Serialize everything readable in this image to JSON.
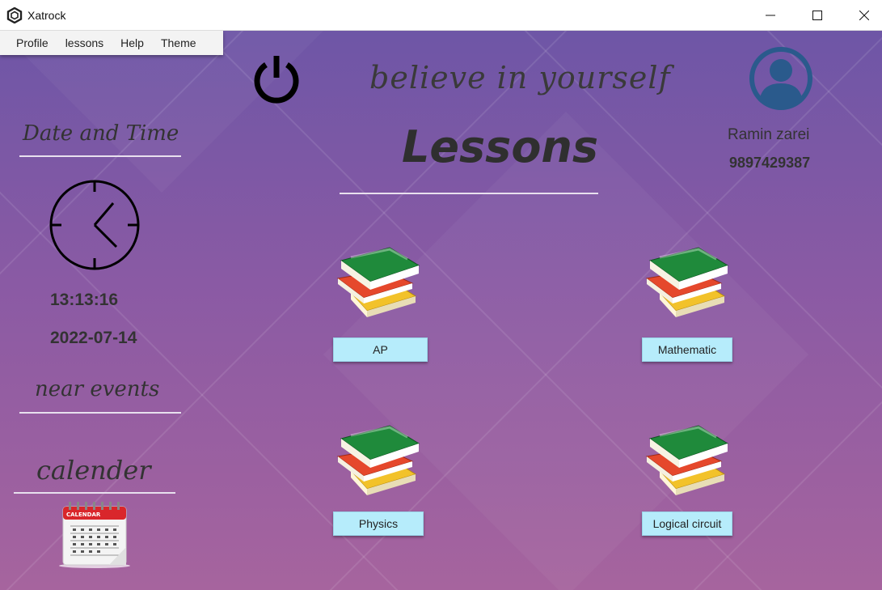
{
  "window": {
    "title": "Xatrock",
    "minimize_icon": "minimize-icon",
    "maximize_icon": "maximize-icon",
    "close_icon": "close-icon"
  },
  "menu": {
    "items": [
      "Profile",
      "lessons",
      "Help",
      "Theme"
    ]
  },
  "header": {
    "motto": "believe in yourself",
    "title": "Lessons"
  },
  "user": {
    "name": "Ramin zarei",
    "phone": "9897429387",
    "avatar_icon": "user-avatar-icon"
  },
  "sidebar": {
    "date_time_label": "Date and Time",
    "time": "13:13:16",
    "date": "2022-07-14",
    "near_events_label": "near events",
    "calendar_label": "calender",
    "calendar_icon_text": "CALENDAR"
  },
  "lessons": [
    {
      "label": "AP"
    },
    {
      "label": "Mathematic"
    },
    {
      "label": "Physics"
    },
    {
      "label": "Logical circuit"
    }
  ],
  "colors": {
    "accent_button": "#b6ecfb",
    "background_top": "#6e56a6",
    "background_bottom": "#a6649e",
    "avatar": "#2a5a8c"
  }
}
